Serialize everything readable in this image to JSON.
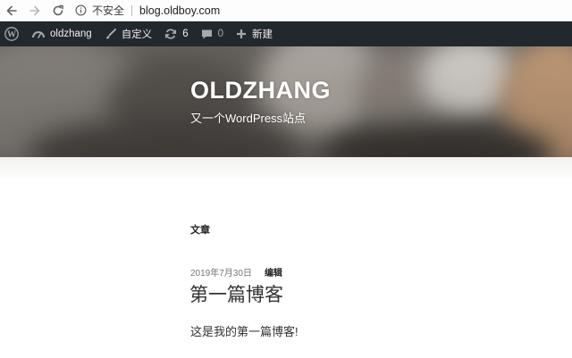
{
  "browser": {
    "insecure_label": "不安全",
    "url": "blog.oldboy.com"
  },
  "admin_bar": {
    "site_name": "oldzhang",
    "customize_label": "自定义",
    "updates_count": "6",
    "comments_count": "0",
    "new_label": "新建"
  },
  "header": {
    "site_title": "OLDZHANG",
    "tagline": "又一个WordPress站点"
  },
  "main": {
    "section_heading": "文章",
    "post": {
      "date": "2019年7月30日",
      "edit_label": "编辑",
      "title": "第一篇博客",
      "excerpt": "这是我的第一篇博客!"
    }
  },
  "colors": {
    "admin_bar_bg": "#23282d",
    "admin_bar_text": "#eeeeee",
    "page_bg": "#ffffff"
  }
}
